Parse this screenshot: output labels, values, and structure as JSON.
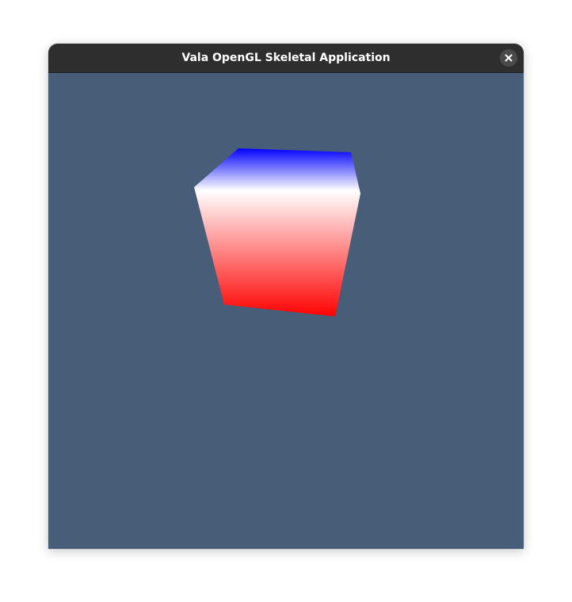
{
  "window": {
    "title": "Vala OpenGL Skeletal Application",
    "close_icon": "close-icon"
  },
  "colors": {
    "titlebar": "#2e2e2e",
    "canvas_background": "#475d78",
    "cube_top": "#0000ff",
    "cube_mid": "#ffffff",
    "cube_bottom": "#ff0000"
  }
}
